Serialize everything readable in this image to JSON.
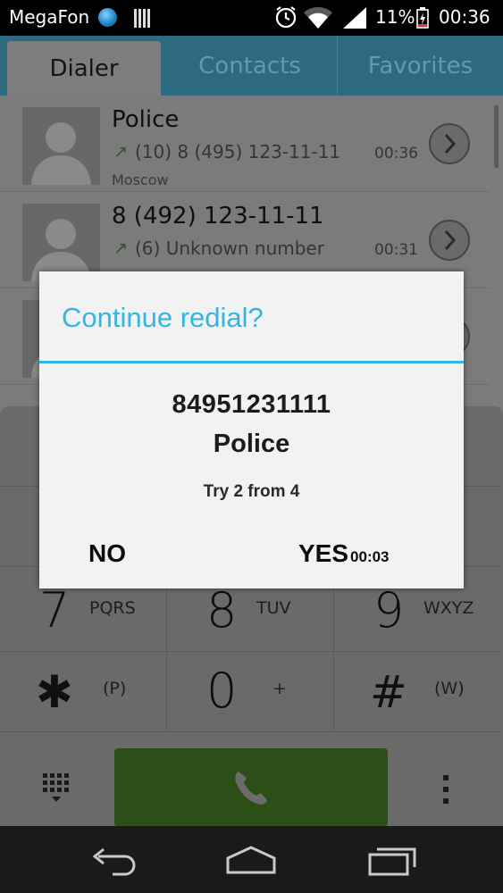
{
  "status_bar": {
    "carrier": "MegaFon",
    "battery_percent": "11%",
    "time": "00:36"
  },
  "tabs": [
    {
      "label": "Dialer",
      "active": true
    },
    {
      "label": "Contacts",
      "active": false
    },
    {
      "label": "Favorites",
      "active": false
    }
  ],
  "call_log": [
    {
      "name": "Police",
      "detail": "(10) 8 (495) 123-11-11",
      "time": "00:36",
      "location": "Moscow"
    },
    {
      "name": "8 (492) 123-11-11",
      "detail": "(6) Unknown number",
      "time": "00:31",
      "location": ""
    }
  ],
  "keypad": {
    "keys": [
      {
        "digit": "7",
        "letters": "PQRS"
      },
      {
        "digit": "8",
        "letters": "TUV"
      },
      {
        "digit": "9",
        "letters": "WXYZ"
      },
      {
        "digit": "✱",
        "letters": "(P)"
      },
      {
        "digit": "0",
        "letters": "+"
      },
      {
        "digit": "#",
        "letters": "(W)"
      }
    ]
  },
  "dialog": {
    "title": "Continue redial?",
    "number": "84951231111",
    "name": "Police",
    "attempt": "Try 2 from 4",
    "no_label": "NO",
    "yes_label": "YES",
    "yes_countdown": "00:03"
  },
  "colors": {
    "accent": "#33b5e5",
    "call_button": "#4c8a2c",
    "outgoing_arrow": "#3a9a2e"
  }
}
